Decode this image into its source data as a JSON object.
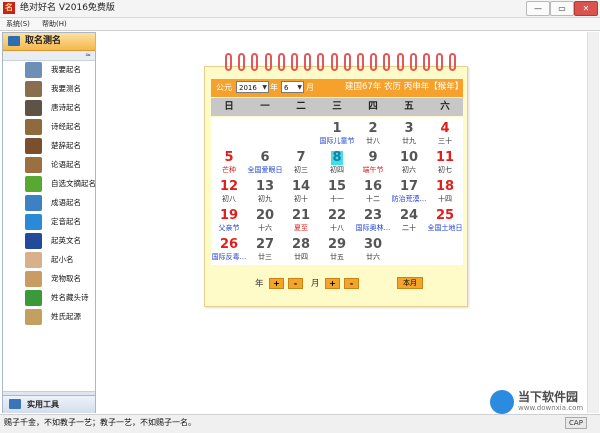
{
  "window": {
    "title": "绝对好名 V2016免费版",
    "icon_text": "名",
    "controls": [
      "—",
      "▭",
      "✕"
    ]
  },
  "menu": [
    "系统(S)",
    "帮助(H)"
  ],
  "sidebar": {
    "header": "取名测名",
    "collapse_glyph": "≈",
    "items": [
      {
        "label": "我要起名",
        "icon": "naming-icon",
        "color": "#6d8fb5"
      },
      {
        "label": "我要测名",
        "icon": "testing-icon",
        "color": "#8a6d4f"
      },
      {
        "label": "唐诗起名",
        "icon": "tang-poem-icon",
        "color": "#5f5347"
      },
      {
        "label": "诗经起名",
        "icon": "shijing-icon",
        "color": "#8f6a3c"
      },
      {
        "label": "楚辞起名",
        "icon": "chuci-icon",
        "color": "#7a4f2e"
      },
      {
        "label": "论语起名",
        "icon": "lunyu-icon",
        "color": "#9a7040"
      },
      {
        "label": "自选文摘起名",
        "icon": "excerpt-icon",
        "color": "#58a832"
      },
      {
        "label": "成语起名",
        "icon": "idiom-icon",
        "color": "#3f7fc4"
      },
      {
        "label": "定音起名",
        "icon": "pronounce-icon",
        "color": "#2b8ad8"
      },
      {
        "label": "起英文名",
        "icon": "uk-flag-icon",
        "color": "#234a9a"
      },
      {
        "label": "起小名",
        "icon": "baby-icon",
        "color": "#d8b08a"
      },
      {
        "label": "宠物取名",
        "icon": "pet-icon",
        "color": "#c89c64"
      },
      {
        "label": "姓名藏头诗",
        "icon": "acrostic-icon",
        "color": "#3a9a3a"
      },
      {
        "label": "姓氏起源",
        "icon": "surname-origin-icon",
        "color": "#c4a060"
      }
    ],
    "footer": "实用工具"
  },
  "calendar": {
    "header": {
      "gongyuan": "公元",
      "year": "2016",
      "year_unit": "年",
      "month": "6",
      "month_unit": "月",
      "lunar_text": "建国67年 农历 丙申年【猴年】"
    },
    "weekdays": [
      "日",
      "一",
      "二",
      "三",
      "四",
      "五",
      "六"
    ],
    "rows": [
      [
        null,
        null,
        null,
        {
          "n": "1",
          "l": "国际儿童节",
          "c": "blue"
        },
        {
          "n": "2",
          "l": "廿八"
        },
        {
          "n": "3",
          "l": "廿九"
        },
        {
          "n": "4",
          "l": "三十",
          "red": true
        }
      ],
      [
        {
          "n": "5",
          "l": "芒种",
          "red": true,
          "c": "red"
        },
        {
          "n": "6",
          "l": "全国爱眼日",
          "c": "blue"
        },
        {
          "n": "7",
          "l": "初三"
        },
        {
          "n": "8",
          "l": "初四",
          "today": true
        },
        {
          "n": "9",
          "l": "端午节",
          "c": "red"
        },
        {
          "n": "10",
          "l": "初六"
        },
        {
          "n": "11",
          "l": "初七",
          "red": true
        }
      ],
      [
        {
          "n": "12",
          "l": "初八",
          "red": true
        },
        {
          "n": "13",
          "l": "初九"
        },
        {
          "n": "14",
          "l": "初十"
        },
        {
          "n": "15",
          "l": "十一"
        },
        {
          "n": "16",
          "l": "十二"
        },
        {
          "n": "17",
          "l": "防治荒漠...",
          "c": "blue"
        },
        {
          "n": "18",
          "l": "十四",
          "red": true
        }
      ],
      [
        {
          "n": "19",
          "l": "父亲节",
          "red": true,
          "c": "blue"
        },
        {
          "n": "20",
          "l": "十六"
        },
        {
          "n": "21",
          "l": "夏至",
          "c": "red"
        },
        {
          "n": "22",
          "l": "十八"
        },
        {
          "n": "23",
          "l": "国际奥林...",
          "c": "blue"
        },
        {
          "n": "24",
          "l": "二十"
        },
        {
          "n": "25",
          "l": "全国土地日",
          "red": true,
          "c": "blue"
        }
      ],
      [
        {
          "n": "26",
          "l": "国际反毒...",
          "red": true,
          "c": "blue"
        },
        {
          "n": "27",
          "l": "廿三"
        },
        {
          "n": "28",
          "l": "廿四"
        },
        {
          "n": "29",
          "l": "廿五"
        },
        {
          "n": "30",
          "l": "廿六"
        },
        null,
        null
      ]
    ],
    "nav": {
      "year_label": "年",
      "month_label": "月",
      "plus": "+",
      "minus": "-",
      "this_month": "本月"
    }
  },
  "status": {
    "text": "赐子千金，不如教子一艺；教子一艺，不如赐子一名。",
    "cap": "CAP"
  },
  "watermark": {
    "name": "当下软件园",
    "url": "www.downxia.com"
  },
  "colors": {
    "accent": "#f6a12b",
    "red": "#e01e1e",
    "blue": "#1e3fd6",
    "today_bg": "#40e0e6"
  }
}
